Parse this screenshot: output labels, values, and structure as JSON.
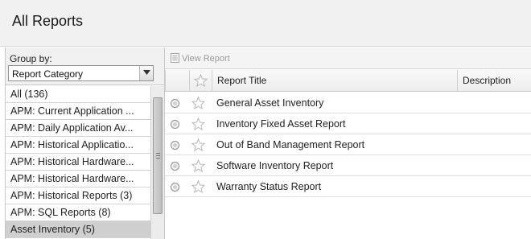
{
  "header": {
    "title": "All Reports"
  },
  "left_panel": {
    "group_by_label": "Group by:",
    "group_by_value": "Report Category",
    "categories": [
      {
        "label": "All (136)"
      },
      {
        "label": "APM: Current Application ..."
      },
      {
        "label": "APM: Daily Application Av..."
      },
      {
        "label": "APM: Historical Applicatio..."
      },
      {
        "label": "APM: Historical Hardware..."
      },
      {
        "label": "APM: Historical Hardware..."
      },
      {
        "label": "APM: Historical Reports (3)"
      },
      {
        "label": "APM: SQL Reports (8)"
      },
      {
        "label": "Asset Inventory (5)"
      }
    ],
    "selected_index": 8
  },
  "toolbar": {
    "view_report_label": "View Report"
  },
  "table": {
    "columns": {
      "report_title": "Report Title",
      "description": "Description"
    },
    "rows": [
      {
        "title": "General Asset Inventory",
        "description": ""
      },
      {
        "title": "Inventory Fixed Asset Report",
        "description": ""
      },
      {
        "title": "Out of Band Management Report",
        "description": ""
      },
      {
        "title": "Software Inventory Report",
        "description": ""
      },
      {
        "title": "Warranty Status Report",
        "description": ""
      }
    ]
  },
  "colors": {
    "header_bg": "#f1f1f1",
    "selected_row": "#cfcfcf",
    "toolbar_disabled_text": "#9a9a9a"
  },
  "icons": {
    "dropdown": "chevron-down-icon",
    "view_report": "report-icon",
    "favorite": "star-icon",
    "select": "radio-icon"
  }
}
